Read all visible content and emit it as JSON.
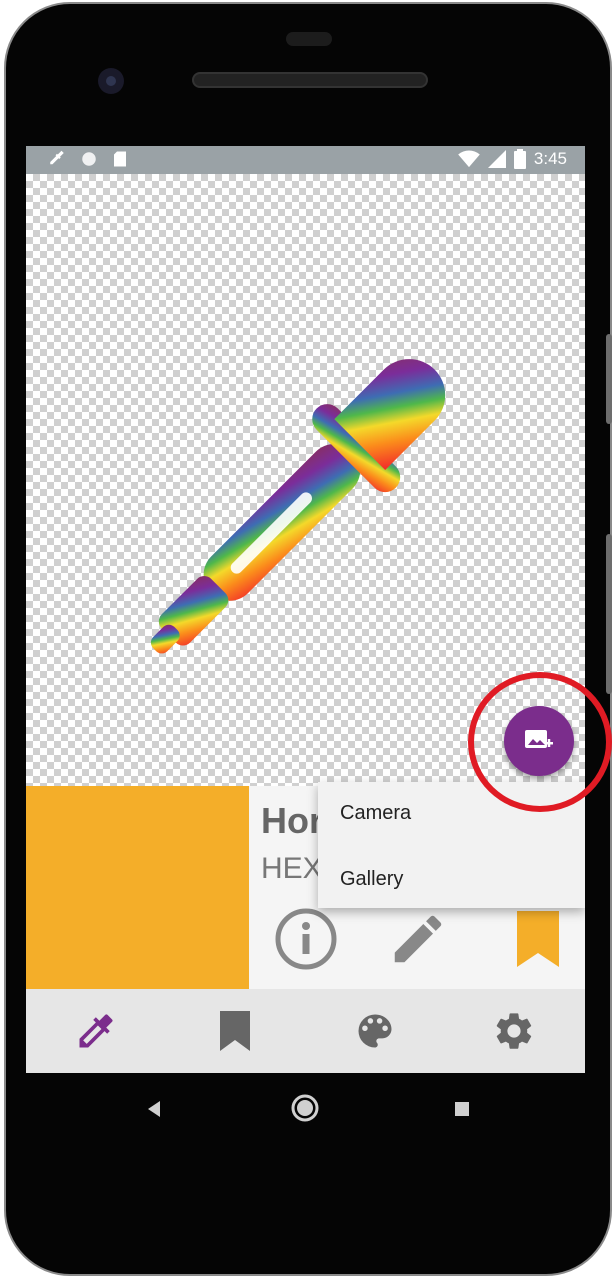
{
  "status_bar": {
    "time": "3:45",
    "left_icons": [
      "eyedropper-icon",
      "circle-icon",
      "sd-card-icon"
    ],
    "right_icons": [
      "wifi-icon",
      "signal-icon",
      "battery-icon"
    ]
  },
  "preview": {
    "image_icon": "rainbow-eyedropper-icon"
  },
  "fab": {
    "icon": "add-image-icon",
    "color": "#7b2d8c"
  },
  "color_panel": {
    "swatch_color": "#f4ae29",
    "name_visible": "Hor",
    "hex_visible": "HEX",
    "actions": [
      "info-icon",
      "edit-icon",
      "bookmark-icon"
    ]
  },
  "popup_menu": {
    "items": [
      "Camera",
      "Gallery"
    ]
  },
  "bottom_nav": {
    "items": [
      "eyedropper-icon",
      "bookmark-icon",
      "palette-icon",
      "settings-icon"
    ],
    "active_color": "#7b2d8c",
    "inactive_color": "#666666"
  },
  "system_nav": {
    "buttons": [
      "back-icon",
      "home-icon",
      "recents-icon"
    ]
  },
  "annotation": {
    "highlight_color": "#e01b24"
  }
}
